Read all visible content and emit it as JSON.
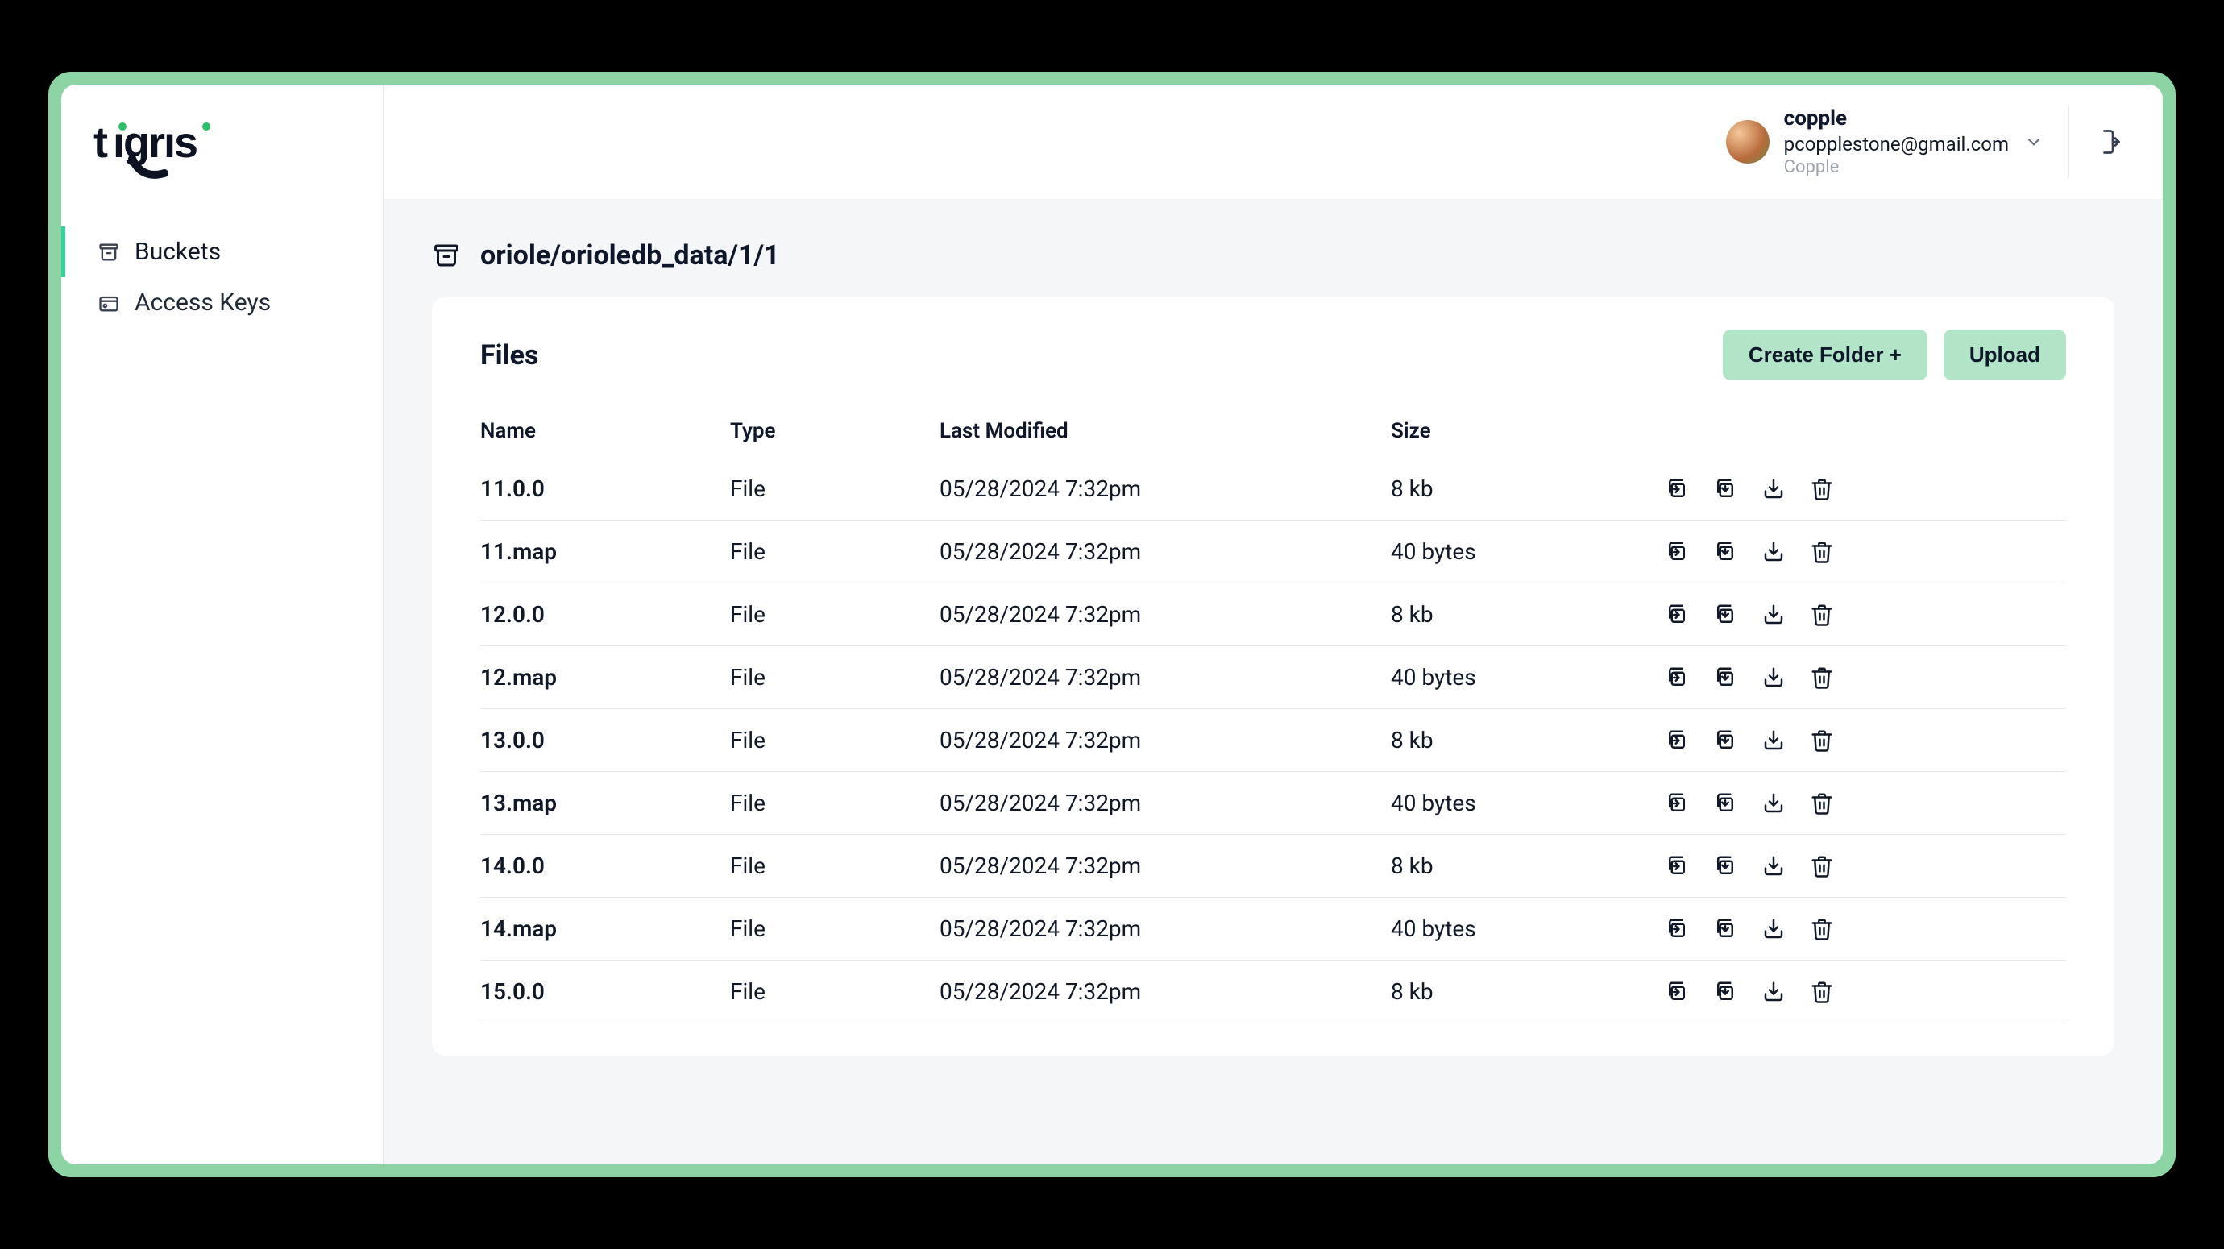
{
  "brand": "tigris",
  "sidebar": {
    "items": [
      {
        "label": "Buckets",
        "active": true,
        "icon": "bucket"
      },
      {
        "label": "Access Keys",
        "active": false,
        "icon": "key"
      }
    ]
  },
  "user": {
    "name": "copple",
    "email": "pcopplestone@gmail.com",
    "org": "Copple"
  },
  "breadcrumb": "oriole/orioledb_data/1/1",
  "card": {
    "title": "Files",
    "create_folder_label": "Create Folder +",
    "upload_label": "Upload"
  },
  "columns": {
    "name": "Name",
    "type": "Type",
    "modified": "Last Modified",
    "size": "Size"
  },
  "files": [
    {
      "name": "11.0.0",
      "type": "File",
      "modified": "05/28/2024 7:32pm",
      "size": "8 kb"
    },
    {
      "name": "11.map",
      "type": "File",
      "modified": "05/28/2024 7:32pm",
      "size": "40 bytes"
    },
    {
      "name": "12.0.0",
      "type": "File",
      "modified": "05/28/2024 7:32pm",
      "size": "8 kb"
    },
    {
      "name": "12.map",
      "type": "File",
      "modified": "05/28/2024 7:32pm",
      "size": "40 bytes"
    },
    {
      "name": "13.0.0",
      "type": "File",
      "modified": "05/28/2024 7:32pm",
      "size": "8 kb"
    },
    {
      "name": "13.map",
      "type": "File",
      "modified": "05/28/2024 7:32pm",
      "size": "40 bytes"
    },
    {
      "name": "14.0.0",
      "type": "File",
      "modified": "05/28/2024 7:32pm",
      "size": "8 kb"
    },
    {
      "name": "14.map",
      "type": "File",
      "modified": "05/28/2024 7:32pm",
      "size": "40 bytes"
    },
    {
      "name": "15.0.0",
      "type": "File",
      "modified": "05/28/2024 7:32pm",
      "size": "8 kb"
    }
  ]
}
